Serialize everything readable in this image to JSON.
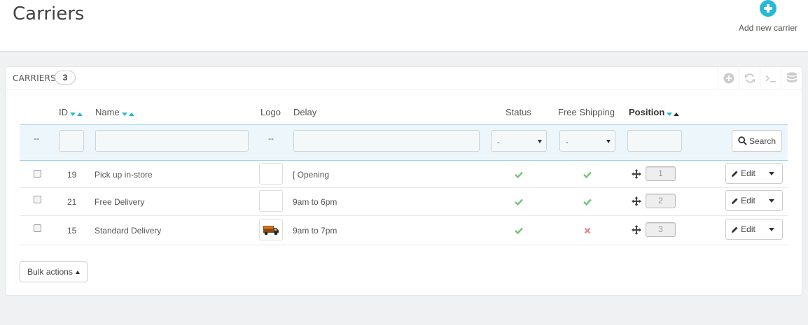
{
  "page": {
    "title": "Carriers",
    "add_label": "Add new carrier"
  },
  "panel": {
    "title": "Carriers",
    "count": "3"
  },
  "columns": {
    "id": "ID",
    "name": "Name",
    "logo": "Logo",
    "delay": "Delay",
    "status": "Status",
    "free_shipping": "Free Shipping",
    "position": "Position"
  },
  "filters": {
    "check_dash": "--",
    "logo_dash": "--",
    "status_value": "-",
    "free_shipping_value": "-",
    "search_label": "Search"
  },
  "rows": [
    {
      "id": "19",
      "name": "Pick up in-store",
      "delay": "[ Opening",
      "status": "enabled",
      "free_shipping": "yes",
      "position": "1",
      "edit_label": "Edit"
    },
    {
      "id": "21",
      "name": "Free Delivery",
      "delay": "9am to 6pm",
      "status": "enabled",
      "free_shipping": "yes",
      "position": "2",
      "edit_label": "Edit"
    },
    {
      "id": "15",
      "name": "Standard Delivery",
      "delay": "9am to 7pm",
      "status": "enabled",
      "free_shipping": "no",
      "position": "3",
      "edit_label": "Edit"
    }
  ],
  "bulk_actions_label": "Bulk actions",
  "colors": {
    "accent": "#25b9d7",
    "check_green": "#72c279",
    "cross_red": "#e08f95"
  }
}
